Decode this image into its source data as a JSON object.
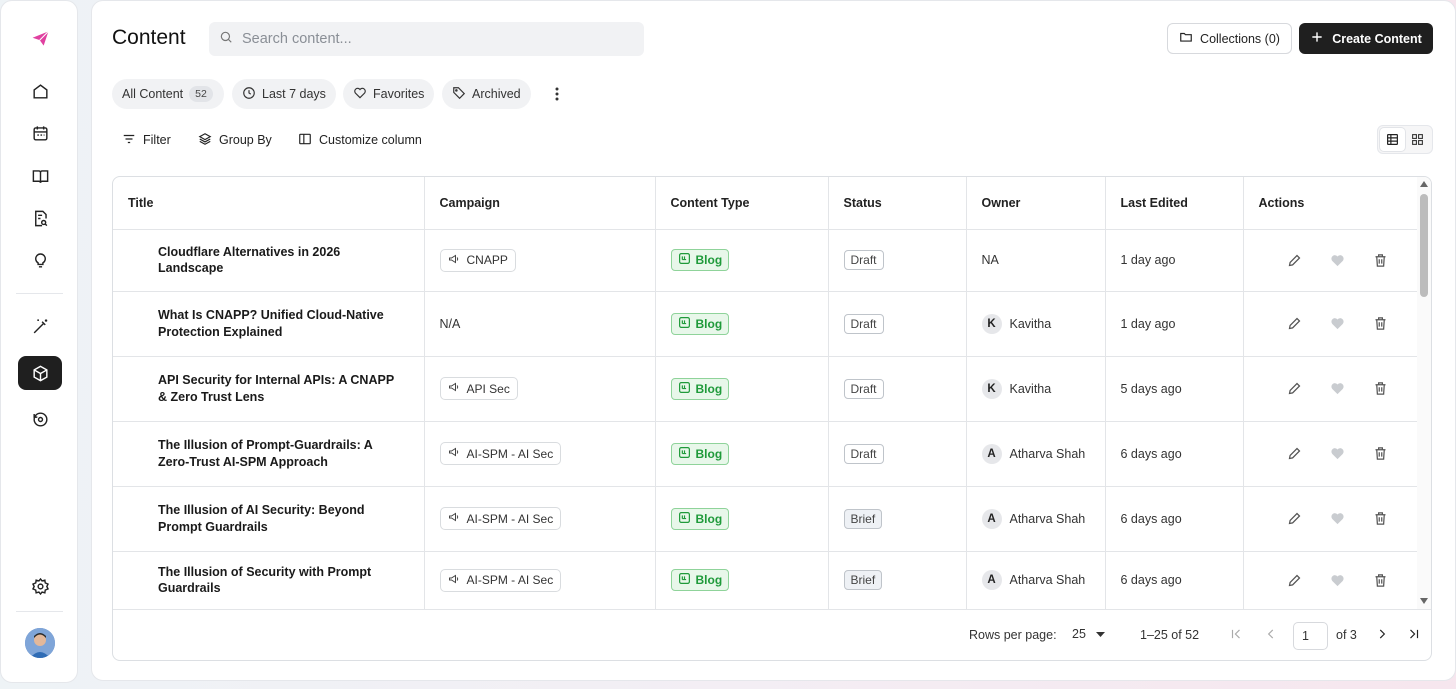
{
  "page": {
    "title": "Content"
  },
  "search": {
    "placeholder": "Search content..."
  },
  "header": {
    "collections_label": "Collections (0)",
    "create_label": "Create Content"
  },
  "chips": [
    {
      "label": "All Content",
      "count": "52"
    },
    {
      "label": "Last 7 days"
    },
    {
      "label": "Favorites"
    },
    {
      "label": "Archived"
    }
  ],
  "toolbar": {
    "filter": "Filter",
    "group_by": "Group By",
    "customize": "Customize column"
  },
  "table": {
    "columns": [
      "Title",
      "Campaign",
      "Content Type",
      "Status",
      "Owner",
      "Last Edited",
      "Actions"
    ],
    "rows": [
      {
        "title": "Cloudflare Alternatives in 2026 Landscape",
        "campaign": "CNAPP",
        "type": "Blog",
        "status": "Draft",
        "owner": "NA",
        "owner_initial": "",
        "edited": "1 day ago"
      },
      {
        "title": "What Is CNAPP? Unified Cloud-Native Protection Explained",
        "campaign": "N/A",
        "type": "Blog",
        "status": "Draft",
        "owner": "Kavitha",
        "owner_initial": "K",
        "edited": "1 day ago"
      },
      {
        "title": "API Security for Internal APIs: A CNAPP & Zero Trust Lens",
        "campaign": "API Sec",
        "type": "Blog",
        "status": "Draft",
        "owner": "Kavitha",
        "owner_initial": "K",
        "edited": "5 days ago"
      },
      {
        "title": "The Illusion of Prompt-Guardrails: A Zero-Trust AI-SPM Approach",
        "campaign": "AI-SPM - AI Sec",
        "type": "Blog",
        "status": "Draft",
        "owner": "Atharva Shah",
        "owner_initial": "A",
        "edited": "6 days ago"
      },
      {
        "title": "The Illusion of AI Security: Beyond Prompt Guardrails",
        "campaign": "AI-SPM - AI Sec",
        "type": "Blog",
        "status": "Brief",
        "owner": "Atharva Shah",
        "owner_initial": "A",
        "edited": "6 days ago"
      },
      {
        "title": "The Illusion of Security with Prompt Guardrails",
        "campaign": "AI-SPM - AI Sec",
        "type": "Blog",
        "status": "Brief",
        "owner": "Atharva Shah",
        "owner_initial": "A",
        "edited": "6 days ago"
      }
    ]
  },
  "pagination": {
    "rows_label": "Rows per page:",
    "rows_value": "25",
    "range": "1–25 of 52",
    "page": "1",
    "of": "of 3"
  },
  "colors": {
    "accent": "#e040a0",
    "dark": "#1f1f1f",
    "blog_green": "#1f9a3a"
  }
}
